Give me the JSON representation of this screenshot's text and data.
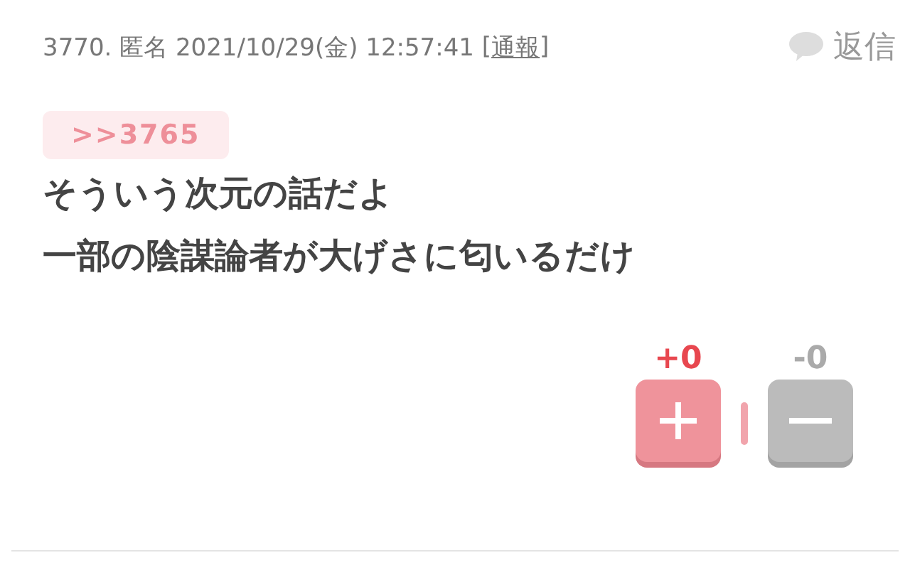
{
  "post": {
    "number": "3770.",
    "author": "匿名",
    "datetime": "2021/10/29(金) 12:57:41",
    "report_open": "[",
    "report_link": "通報",
    "report_close": "]",
    "reply_label": "返信"
  },
  "anchor": ">>3765",
  "body_lines": [
    "そういう次元の話だよ",
    "一部の陰謀論者が大げさに匂いるだけ"
  ],
  "votes": {
    "plus_count": "+0",
    "minus_count": "-0"
  }
}
